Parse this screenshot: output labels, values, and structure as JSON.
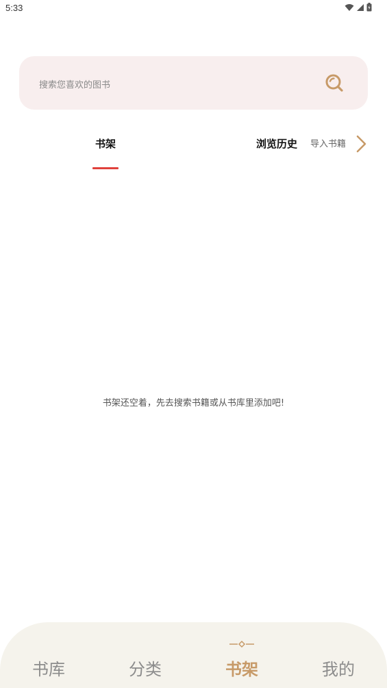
{
  "status_bar": {
    "time": "5:33"
  },
  "search": {
    "placeholder": "搜索您喜欢的图书"
  },
  "tabs": {
    "shelf": "书架",
    "history": "浏览历史",
    "import": "导入书籍"
  },
  "empty_state": {
    "message": "书架还空着，先去搜索书籍或从书库里添加吧!"
  },
  "bottom_nav": {
    "items": [
      {
        "label": "书库",
        "active": false
      },
      {
        "label": "分类",
        "active": false
      },
      {
        "label": "书架",
        "active": true
      },
      {
        "label": "我的",
        "active": false
      }
    ]
  },
  "colors": {
    "accent": "#c79a68",
    "tab_indicator": "#e0413c",
    "search_background": "#f8eeee",
    "nav_background": "#f5f3ec"
  },
  "icons": [
    "wifi-icon",
    "signal-icon",
    "battery-icon",
    "search-icon",
    "chevron-right-icon",
    "nav-ornament-icon"
  ]
}
